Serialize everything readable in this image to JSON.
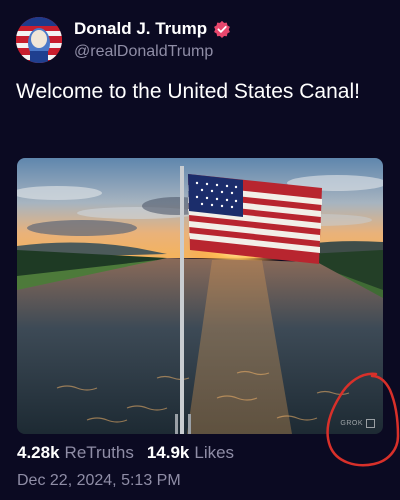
{
  "author": {
    "display_name": "Donald J. Trump",
    "handle": "@realDonaldTrump"
  },
  "post": {
    "text": "Welcome to the United States Canal!",
    "media_watermark": "GROK"
  },
  "stats": {
    "retruths_count": "4.28k",
    "retruths_label": "ReTruths",
    "likes_count": "14.9k",
    "likes_label": "Likes"
  },
  "timestamp": "Dec 22, 2024, 5:13 PM",
  "colors": {
    "background": "#0b0a22",
    "verified_badge": "#e8476d",
    "secondary_text": "#8f8da6",
    "annotation": "#d8302a"
  },
  "icons": {
    "verified": "verified-badge-icon"
  }
}
